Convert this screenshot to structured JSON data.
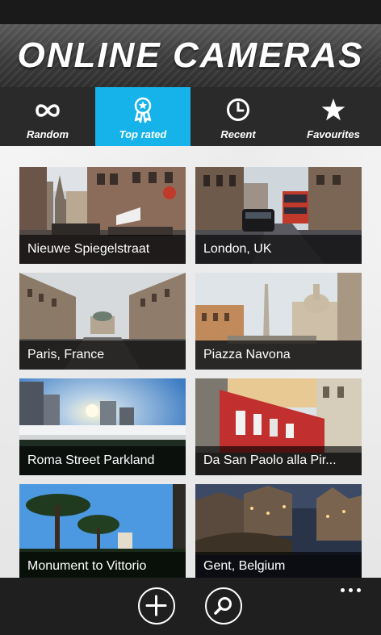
{
  "app": {
    "title": "ONLINE CAMERAS",
    "accent_color": "#15b3ea"
  },
  "tabs": [
    {
      "label": "Random",
      "icon": "infinity-icon"
    },
    {
      "label": "Top rated",
      "icon": "award-ribbon-icon",
      "active": true
    },
    {
      "label": "Recent",
      "icon": "clock-icon"
    },
    {
      "label": "Favourites",
      "icon": "star-icon"
    }
  ],
  "cameras": [
    {
      "name": "Nieuwe Spiegelstraat"
    },
    {
      "name": "London,  UK"
    },
    {
      "name": "Paris, France"
    },
    {
      "name": "Piazza Navona"
    },
    {
      "name": "Roma Street Parkland"
    },
    {
      "name": "Da San Paolo alla Pir..."
    },
    {
      "name": "Monument to Vittorio"
    },
    {
      "name": "Gent, Belgium"
    }
  ],
  "appbar": {
    "buttons": [
      {
        "icon": "add-icon"
      },
      {
        "icon": "search-icon"
      }
    ],
    "more_icon": "ellipsis-icon"
  }
}
